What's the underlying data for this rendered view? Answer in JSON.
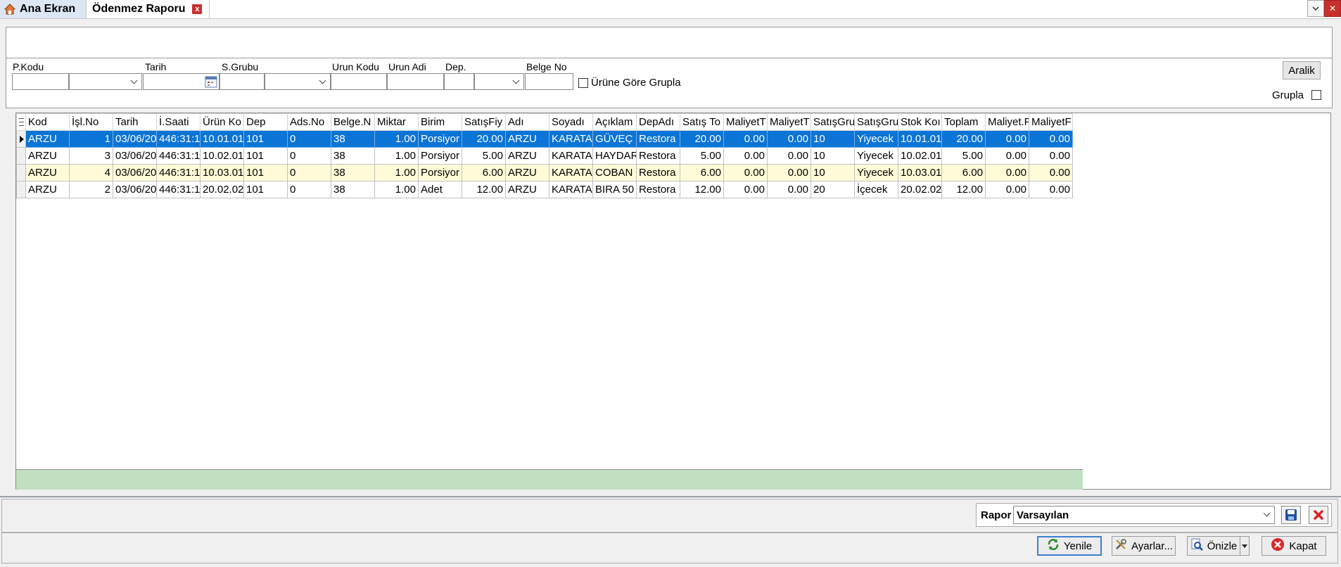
{
  "tabs": [
    {
      "label": "Ana Ekran"
    },
    {
      "label": "Ödenmez Raporu"
    }
  ],
  "filters": {
    "labels": {
      "pkodu": "P.Kodu",
      "tarih": "Tarih",
      "sgrubu": "S.Grubu",
      "urunkodu": "Urun Kodu",
      "urunadi": "Urun Adi",
      "dep": "Dep.",
      "belgeno": "Belge No"
    },
    "urune_gore_grupla": "Ürüne Göre Grupla",
    "aralik": "Aralik",
    "grupla": "Grupla"
  },
  "grid": {
    "columns": [
      "Kod",
      "İşl.No",
      "Tarih",
      "İ.Saati",
      "Ürün Ko",
      "Dep",
      "Ads.No",
      "Belge.N",
      "Miktar",
      "Birim",
      "SatışFiy",
      "Adı",
      "Soyadı",
      "Açıklam",
      "DepAdı",
      "Satış To",
      "MaliyetT",
      "MaliyetT",
      "SatışGru",
      "SatışGru",
      "Stok Koı",
      "Toplam",
      "Maliyet.F",
      "MaliyetF"
    ],
    "rows": [
      [
        "ARZU",
        "1",
        "03/06/20",
        "446:31:1",
        "10.01.01",
        "101",
        "0",
        "38",
        "1.00",
        "Porsiyor",
        "20.00",
        "ARZU",
        "KARATA",
        "GÜVEÇ",
        "Restora",
        "20.00",
        "0.00",
        "0.00",
        "10",
        "Yiyecek",
        "10.01.01",
        "20.00",
        "0.00",
        "0.00"
      ],
      [
        "ARZU",
        "3",
        "03/06/20",
        "446:31:1",
        "10.02.01",
        "101",
        "0",
        "38",
        "1.00",
        "Porsiyor",
        "5.00",
        "ARZU",
        "KARATA",
        "HAYDAR",
        "Restora",
        "5.00",
        "0.00",
        "0.00",
        "10",
        "Yiyecek",
        "10.02.01",
        "5.00",
        "0.00",
        "0.00"
      ],
      [
        "ARZU",
        "4",
        "03/06/20",
        "446:31:1",
        "10.03.01",
        "101",
        "0",
        "38",
        "1.00",
        "Porsiyor",
        "6.00",
        "ARZU",
        "KARATA",
        "COBAN",
        "Restora",
        "6.00",
        "0.00",
        "0.00",
        "10",
        "Yiyecek",
        "10.03.01",
        "6.00",
        "0.00",
        "0.00"
      ],
      [
        "ARZU",
        "2",
        "03/06/20",
        "446:31:1",
        "20.02.02",
        "101",
        "0",
        "38",
        "1.00",
        "Adet",
        "12.00",
        "ARZU",
        "KARATA",
        "BIRA 50",
        "Restora",
        "12.00",
        "0.00",
        "0.00",
        "20",
        "İçecek",
        "20.02.02",
        "12.00",
        "0.00",
        "0.00"
      ]
    ]
  },
  "rapor": {
    "label": "Rapor",
    "value": "Varsayılan"
  },
  "buttons": {
    "yenile": "Yenile",
    "ayarlar": "Ayarlar...",
    "onizle": "Önizle",
    "kapat": "Kapat"
  }
}
